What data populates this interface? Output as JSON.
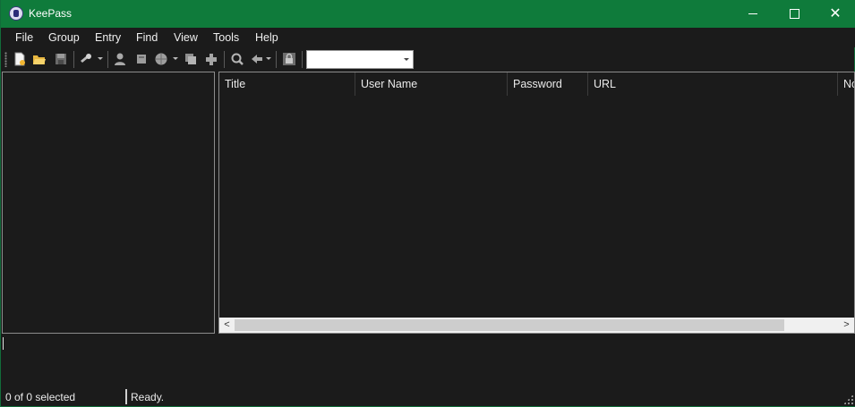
{
  "window": {
    "title": "KeePass",
    "titlebar_color": "#0f7b3b"
  },
  "menu": [
    "File",
    "Group",
    "Entry",
    "Find",
    "View",
    "Tools",
    "Help"
  ],
  "toolbar": {
    "icons": [
      "new-database-icon",
      "open-database-icon",
      "save-database-icon",
      "add-entry-icon",
      "copy-username-icon",
      "copy-password-icon",
      "open-url-icon",
      "copy-entries-icon",
      "perform-autotype-icon",
      "find-icon",
      "show-entries-icon",
      "lock-workspace-icon"
    ],
    "quick_search_value": ""
  },
  "entry_list": {
    "columns": [
      "Title",
      "User Name",
      "Password",
      "URL",
      "Notes"
    ],
    "rows": []
  },
  "status": {
    "selection": "0 of 0 selected",
    "message": "Ready."
  }
}
